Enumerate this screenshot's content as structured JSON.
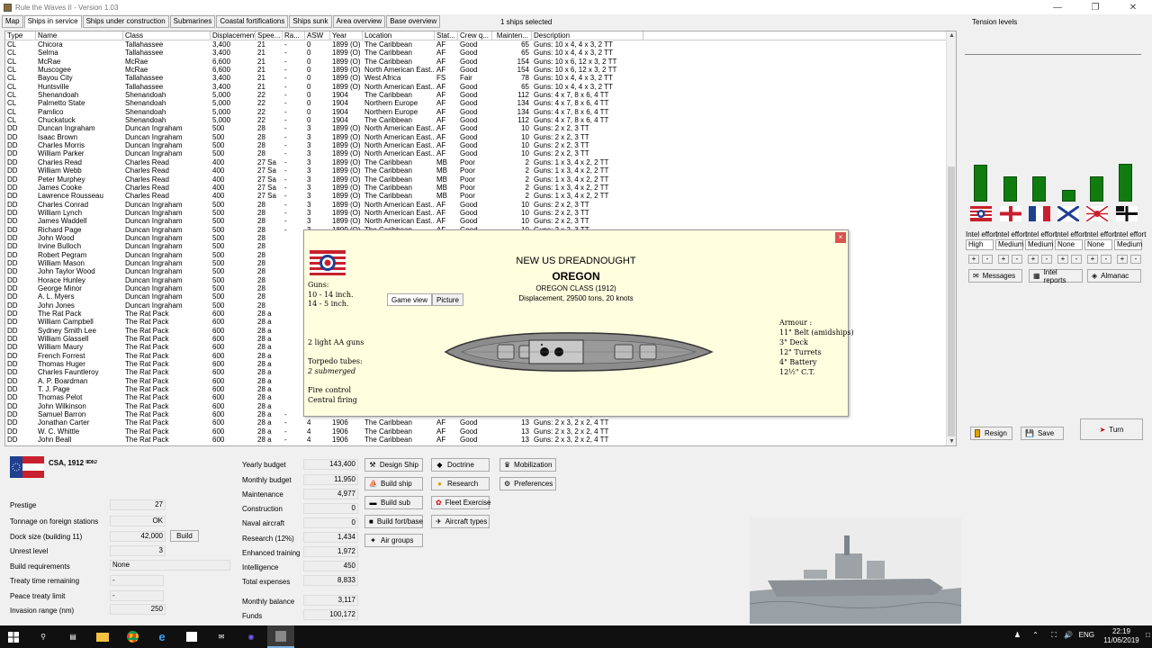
{
  "window": {
    "title": "Rule the Waves II - Version 1.03"
  },
  "tabs": [
    "Map",
    "Ships in service",
    "Ships under construction",
    "Submarines",
    "Coastal fortifications",
    "Ships sunk",
    "Area overview",
    "Base overview"
  ],
  "selection_text": "1 ships selected",
  "tension_label": "Tension levels",
  "table": {
    "columns": [
      "Type",
      "Name",
      "Class",
      "Displacement",
      "Spee...",
      "Ra...",
      "ASW",
      "Year",
      "Location",
      "Stat...",
      "Crew q...",
      "Mainten...",
      "Description"
    ],
    "rows": [
      [
        "CL",
        "Chicora",
        "Tallahassee",
        "3,400",
        "21",
        "-",
        "0",
        "1899 (O)",
        "The Caribbean",
        "AF",
        "Good",
        "65",
        "Guns: 10 x 4, 4 x 3, 2 TT"
      ],
      [
        "CL",
        "Selma",
        "Tallahassee",
        "3,400",
        "21",
        "-",
        "0",
        "1899 (O)",
        "The Caribbean",
        "AF",
        "Good",
        "65",
        "Guns: 10 x 4, 4 x 3, 2 TT"
      ],
      [
        "CL",
        "McRae",
        "McRae",
        "6,600",
        "21",
        "-",
        "0",
        "1899 (O)",
        "The Caribbean",
        "AF",
        "Good",
        "154",
        "Guns: 10 x 6, 12 x 3, 2 TT"
      ],
      [
        "CL",
        "Muscogee",
        "McRae",
        "6,600",
        "21",
        "-",
        "0",
        "1899 (O)",
        "North American East...",
        "AF",
        "Good",
        "154",
        "Guns: 10 x 6, 12 x 3, 2 TT"
      ],
      [
        "CL",
        "Bayou City",
        "Tallahassee",
        "3,400",
        "21",
        "-",
        "0",
        "1899 (O)",
        "West Africa",
        "FS",
        "Fair",
        "78",
        "Guns: 10 x 4, 4 x 3, 2 TT"
      ],
      [
        "CL",
        "Huntsville",
        "Tallahassee",
        "3,400",
        "21",
        "-",
        "0",
        "1899 (O)",
        "North American East...",
        "AF",
        "Good",
        "65",
        "Guns: 10 x 4, 4 x 3, 2 TT"
      ],
      [
        "CL",
        "Shenandoah",
        "Shenandoah",
        "5,000",
        "22",
        "-",
        "0",
        "1904",
        "The Caribbean",
        "AF",
        "Good",
        "112",
        "Guns: 4 x 7, 8 x 6, 4 TT"
      ],
      [
        "CL",
        "Palmetto State",
        "Shenandoah",
        "5,000",
        "22",
        "-",
        "0",
        "1904",
        "Northern Europe",
        "AF",
        "Good",
        "134",
        "Guns: 4 x 7, 8 x 6, 4 TT"
      ],
      [
        "CL",
        "Pamlico",
        "Shenandoah",
        "5,000",
        "22",
        "-",
        "0",
        "1904",
        "Northern Europe",
        "AF",
        "Good",
        "134",
        "Guns: 4 x 7, 8 x 6, 4 TT"
      ],
      [
        "CL",
        "Chuckatuck",
        "Shenandoah",
        "5,000",
        "22",
        "-",
        "0",
        "1904",
        "The Caribbean",
        "AF",
        "Good",
        "112",
        "Guns: 4 x 7, 8 x 6, 4 TT"
      ],
      [
        "DD",
        "Duncan Ingraham",
        "Duncan Ingraham",
        "500",
        "28",
        "-",
        "3",
        "1899 (O)",
        "North American East...",
        "AF",
        "Good",
        "10",
        "Guns: 2 x 2, 3 TT"
      ],
      [
        "DD",
        "Isaac Brown",
        "Duncan Ingraham",
        "500",
        "28",
        "-",
        "3",
        "1899 (O)",
        "North American East...",
        "AF",
        "Good",
        "10",
        "Guns: 2 x 2, 3 TT"
      ],
      [
        "DD",
        "Charles Morris",
        "Duncan Ingraham",
        "500",
        "28",
        "-",
        "3",
        "1899 (O)",
        "North American East...",
        "AF",
        "Good",
        "10",
        "Guns: 2 x 2, 3 TT"
      ],
      [
        "DD",
        "William Parker",
        "Duncan Ingraham",
        "500",
        "28",
        "-",
        "3",
        "1899 (O)",
        "North American East...",
        "AF",
        "Good",
        "10",
        "Guns: 2 x 2, 3 TT"
      ],
      [
        "DD",
        "Charles Read",
        "Charles Read",
        "400",
        "27 Sa",
        "-",
        "3",
        "1899 (O)",
        "The Caribbean",
        "MB",
        "Poor",
        "2",
        "Guns: 1 x 3, 4 x 2, 2 TT"
      ],
      [
        "DD",
        "William Webb",
        "Charles Read",
        "400",
        "27 Sa",
        "-",
        "3",
        "1899 (O)",
        "The Caribbean",
        "MB",
        "Poor",
        "2",
        "Guns: 1 x 3, 4 x 2, 2 TT"
      ],
      [
        "DD",
        "Peter Murphey",
        "Charles Read",
        "400",
        "27 Sa",
        "-",
        "3",
        "1899 (O)",
        "The Caribbean",
        "MB",
        "Poor",
        "2",
        "Guns: 1 x 3, 4 x 2, 2 TT"
      ],
      [
        "DD",
        "James Cooke",
        "Charles Read",
        "400",
        "27 Sa",
        "-",
        "3",
        "1899 (O)",
        "The Caribbean",
        "MB",
        "Poor",
        "2",
        "Guns: 1 x 3, 4 x 2, 2 TT"
      ],
      [
        "DD",
        "Lawrence Rousseau",
        "Charles Read",
        "400",
        "27 Sa",
        "-",
        "3",
        "1899 (O)",
        "The Caribbean",
        "MB",
        "Poor",
        "2",
        "Guns: 1 x 3, 4 x 2, 2 TT"
      ],
      [
        "DD",
        "Charles Conrad",
        "Duncan Ingraham",
        "500",
        "28",
        "-",
        "3",
        "1899 (O)",
        "North American East...",
        "AF",
        "Good",
        "10",
        "Guns: 2 x 2, 3 TT"
      ],
      [
        "DD",
        "William Lynch",
        "Duncan Ingraham",
        "500",
        "28",
        "-",
        "3",
        "1899 (O)",
        "North American East...",
        "AF",
        "Good",
        "10",
        "Guns: 2 x 2, 3 TT"
      ],
      [
        "DD",
        "James Waddell",
        "Duncan Ingraham",
        "500",
        "28",
        "-",
        "3",
        "1899 (O)",
        "North American East...",
        "AF",
        "Good",
        "10",
        "Guns: 2 x 2, 3 TT"
      ],
      [
        "DD",
        "Richard Page",
        "Duncan Ingraham",
        "500",
        "28",
        "-",
        "3",
        "1899 (O)",
        "The Caribbean",
        "AF",
        "Good",
        "10",
        "Guns: 2 x 2, 3 TT"
      ],
      [
        "DD",
        "John Wood",
        "Duncan Ingraham",
        "500",
        "28",
        "",
        "",
        "",
        "",
        "",
        "",
        "",
        ""
      ],
      [
        "DD",
        "Irvine Bulloch",
        "Duncan Ingraham",
        "500",
        "28",
        "",
        "",
        "",
        "",
        "",
        "",
        "",
        ""
      ],
      [
        "DD",
        "Robert Pegram",
        "Duncan Ingraham",
        "500",
        "28",
        "",
        "",
        "",
        "",
        "",
        "",
        "",
        ""
      ],
      [
        "DD",
        "William Mason",
        "Duncan Ingraham",
        "500",
        "28",
        "",
        "",
        "",
        "",
        "",
        "",
        "",
        ""
      ],
      [
        "DD",
        "John Taylor Wood",
        "Duncan Ingraham",
        "500",
        "28",
        "",
        "",
        "",
        "",
        "",
        "",
        "",
        ""
      ],
      [
        "DD",
        "Horace Hunley",
        "Duncan Ingraham",
        "500",
        "28",
        "",
        "",
        "",
        "",
        "",
        "",
        "",
        ""
      ],
      [
        "DD",
        "George Minor",
        "Duncan Ingraham",
        "500",
        "28",
        "",
        "",
        "",
        "",
        "",
        "",
        "",
        ""
      ],
      [
        "DD",
        "A. L. Myers",
        "Duncan Ingraham",
        "500",
        "28",
        "",
        "",
        "",
        "",
        "",
        "",
        "",
        ""
      ],
      [
        "DD",
        "John Jones",
        "Duncan Ingraham",
        "500",
        "28",
        "",
        "",
        "",
        "",
        "",
        "",
        "",
        ""
      ],
      [
        "DD",
        "The Rat Pack",
        "The Rat Pack",
        "600",
        "28 a",
        "",
        "",
        "",
        "",
        "",
        "",
        "",
        ""
      ],
      [
        "DD",
        "William Campbell",
        "The Rat Pack",
        "600",
        "28 a",
        "",
        "",
        "",
        "",
        "",
        "",
        "",
        ""
      ],
      [
        "DD",
        "Sydney Smith Lee",
        "The Rat Pack",
        "600",
        "28 a",
        "",
        "",
        "",
        "",
        "",
        "",
        "",
        ""
      ],
      [
        "DD",
        "William Glassell",
        "The Rat Pack",
        "600",
        "28 a",
        "",
        "",
        "",
        "",
        "",
        "",
        "",
        ""
      ],
      [
        "DD",
        "William Maury",
        "The Rat Pack",
        "600",
        "28 a",
        "",
        "",
        "",
        "",
        "",
        "",
        "",
        ""
      ],
      [
        "DD",
        "French Forrest",
        "The Rat Pack",
        "600",
        "28 a",
        "",
        "",
        "",
        "",
        "",
        "",
        "",
        ""
      ],
      [
        "DD",
        "Thomas Huger",
        "The Rat Pack",
        "600",
        "28 a",
        "",
        "",
        "",
        "",
        "",
        "",
        "",
        ""
      ],
      [
        "DD",
        "Charles Fauntleroy",
        "The Rat Pack",
        "600",
        "28 a",
        "",
        "",
        "",
        "",
        "",
        "",
        "",
        ""
      ],
      [
        "DD",
        "A. P. Boardman",
        "The Rat Pack",
        "600",
        "28 a",
        "",
        "",
        "",
        "",
        "",
        "",
        "",
        ""
      ],
      [
        "DD",
        "T. J. Page",
        "The Rat Pack",
        "600",
        "28 a",
        "",
        "",
        "",
        "",
        "",
        "",
        "",
        ""
      ],
      [
        "DD",
        "Thomas Pelot",
        "The Rat Pack",
        "600",
        "28 a",
        "",
        "",
        "",
        "",
        "",
        "",
        "",
        ""
      ],
      [
        "DD",
        "John Wilkinson",
        "The Rat Pack",
        "600",
        "28 a",
        "",
        "",
        "",
        "",
        "",
        "",
        "",
        ""
      ],
      [
        "DD",
        "Samuel Barron",
        "The Rat Pack",
        "600",
        "28 a",
        "-",
        "4",
        "1906",
        "The Caribbean",
        "AF",
        "Good",
        "13",
        "Guns: 2 x 3, 2 x 2, 4 TT"
      ],
      [
        "DD",
        "Jonathan Carter",
        "The Rat Pack",
        "600",
        "28 a",
        "-",
        "4",
        "1906",
        "The Caribbean",
        "AF",
        "Good",
        "13",
        "Guns: 2 x 3, 2 x 2, 4 TT"
      ],
      [
        "DD",
        "W. C. Whittle",
        "The Rat Pack",
        "600",
        "28 a",
        "-",
        "4",
        "1906",
        "The Caribbean",
        "AF",
        "Good",
        "13",
        "Guns: 2 x 3, 2 x 2, 4 TT"
      ],
      [
        "DD",
        "John Beall",
        "The Rat Pack",
        "600",
        "28 a",
        "-",
        "4",
        "1906",
        "The Caribbean",
        "AF",
        "Good",
        "13",
        "Guns: 2 x 3, 2 x 2, 4 TT"
      ]
    ]
  },
  "dialog": {
    "title": "NEW US DREADNOUGHT",
    "name": "OREGON",
    "class_line": "OREGON CLASS (1912)",
    "disp_line": "Displacement, 29500 tons, 20 knots",
    "btn_game_view": "Game view",
    "btn_picture": "Picture",
    "guns_label": "Guns:",
    "guns_1": "10 - 14 inch.",
    "guns_2": "14 - 5 inch.",
    "aa": "2 light AA guns",
    "torp_label": "Torpedo tubes:",
    "torp_val": "2  submerged",
    "fc1": "Fire control",
    "fc2": "Central firing",
    "armour_label": "Armour :",
    "armour": [
      "11\" Belt (amidships)",
      "3\" Deck",
      "12\" Turrets",
      "4\" Battery",
      "12½\" C.T."
    ],
    "close": "×"
  },
  "country": {
    "name": "CSA, 1912",
    "name_suffix": "ᴵᴵᴰᴵᴵᴶ"
  },
  "stats": [
    {
      "label": "Prestige",
      "value": "27"
    },
    {
      "label": "Tonnage on foreign stations",
      "value": "OK"
    },
    {
      "label": "Dock size (building 11)",
      "value": "42,000"
    },
    {
      "label": "Unrest level",
      "value": "3"
    },
    {
      "label": "Build requirements",
      "value": "None"
    },
    {
      "label": "Treaty time remaining",
      "value": "-"
    },
    {
      "label": "Peace treaty limit",
      "value": "-"
    },
    {
      "label": "Invasion range (nm)",
      "value": "250"
    }
  ],
  "build_btn": "Build",
  "economy": [
    {
      "label": "Yearly budget",
      "value": "143,400"
    },
    {
      "label": "Monthly budget",
      "value": "11,950"
    },
    {
      "label": "Maintenance",
      "value": "4,977"
    },
    {
      "label": "Construction",
      "value": "0"
    },
    {
      "label": "Naval aircraft",
      "value": "0"
    },
    {
      "label": "Research (12%)",
      "value": "1,434"
    },
    {
      "label": "Enhanced training",
      "value": "1,972"
    },
    {
      "label": "Intelligence",
      "value": "450"
    },
    {
      "label": "Total expenses",
      "value": "8,833"
    },
    {
      "label": "Monthly balance",
      "value": "3,117"
    },
    {
      "label": "Funds",
      "value": "100,172"
    }
  ],
  "actions": {
    "design_ship": "Design Ship",
    "build_ship": "Build ship",
    "build_sub": "Build sub",
    "build_fort": "Build fort/base",
    "air_groups": "Air groups",
    "doctrine": "Doctrine",
    "research": "Research",
    "fleet_exercise": "Fleet Exercise",
    "aircraft_types": "Aircraft types",
    "mobilization": "Mobilization",
    "preferences": "Preferences"
  },
  "intel": {
    "label": "Intel effort",
    "tension_levels": [
      0.62,
      0.42,
      0.42,
      0.2,
      0.43,
      0.64
    ],
    "values": [
      "High",
      "Medium",
      "Medium",
      "None",
      "None",
      "Medium"
    ],
    "plus": "+",
    "minus": "-"
  },
  "right_buttons": {
    "messages": "Messages",
    "intel_reports": "Intel reports",
    "almanac": "Almanac",
    "resign": "Resign",
    "save": "Save",
    "turn": "Turn"
  },
  "colors": {
    "tension_bar": "#107c10",
    "dialog_bg": "#ffffe0"
  },
  "taskbar": {
    "lang": "ENG",
    "time": "22:19",
    "date": "11/06/2019"
  }
}
